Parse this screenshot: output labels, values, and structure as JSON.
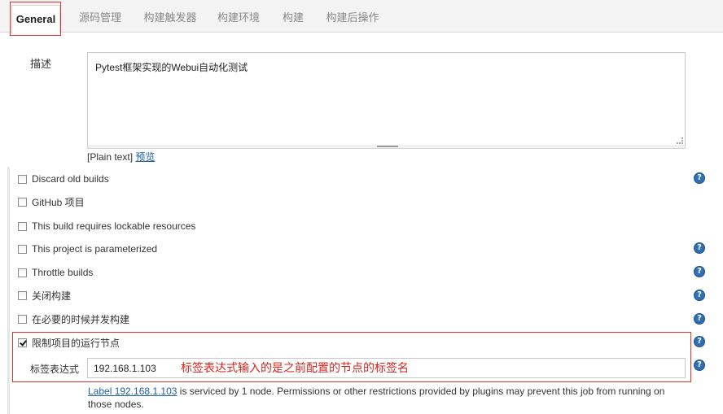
{
  "tabs": [
    {
      "label": "General",
      "active": true
    },
    {
      "label": "源码管理"
    },
    {
      "label": "构建触发器"
    },
    {
      "label": "构建环境"
    },
    {
      "label": "构建"
    },
    {
      "label": "构建后操作"
    }
  ],
  "description": {
    "label": "描述",
    "value": "Pytest框架实现的Webui自动化测试",
    "format_text": "[Plain text]",
    "preview_link": "预览"
  },
  "options": [
    {
      "label": "Discard old builds",
      "checked": false,
      "help": true
    },
    {
      "label": "GitHub 项目",
      "checked": false,
      "help": false
    },
    {
      "label": "This build requires lockable resources",
      "checked": false,
      "help": false
    },
    {
      "label": "This project is parameterized",
      "checked": false,
      "help": true
    },
    {
      "label": "Throttle builds",
      "checked": false,
      "help": true
    },
    {
      "label": "关闭构建",
      "checked": false,
      "help": true
    },
    {
      "label": "在必要的时候并发构建",
      "checked": false,
      "help": true
    },
    {
      "label": "限制项目的运行节点",
      "checked": true,
      "help": true
    }
  ],
  "label_expression": {
    "label": "标签表达式",
    "value": "192.168.1.103",
    "annotation": "标签表达式输入的是之前配置的节点的标签名",
    "info_link": "Label 192.168.1.103",
    "info_text": " is serviced by 1 node. Permissions or other restrictions provided by plugins may prevent this job from running on those nodes."
  },
  "help_glyph": "?",
  "colors": {
    "highlight": "#e0312f",
    "link": "#1c5ea8",
    "help": "#2f6fb5",
    "annotation": "#d9241e"
  }
}
